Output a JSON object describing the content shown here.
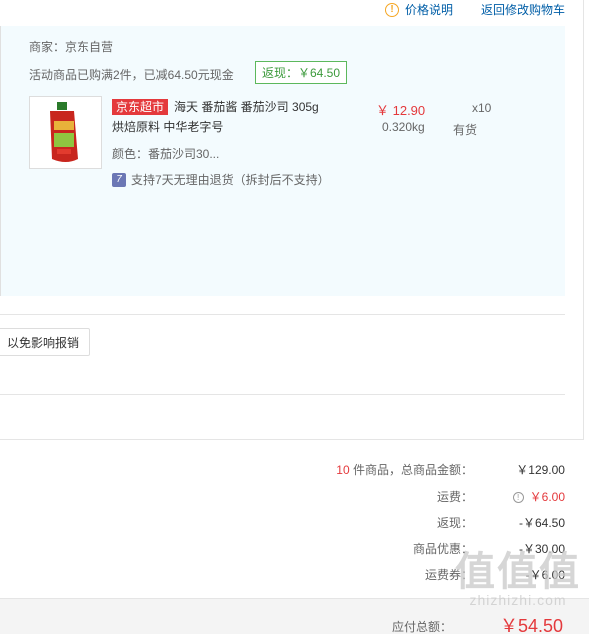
{
  "top_links": {
    "price_info": "价格说明",
    "back_to_cart": "返回修改购物车"
  },
  "shop": {
    "merchant": "商家：京东自营",
    "promo": "活动商品已购满2件，已减64.50元现金",
    "rebate_tag": "返现：￥64.50"
  },
  "product": {
    "badge": "京东超市",
    "name": "海天 番茄酱 番茄沙司 305g",
    "sub": "烘焙原料 中华老字号",
    "color": "颜色：番茄沙司30...",
    "return_policy": "支持7天无理由退货（拆封后不支持）",
    "unit_price": "￥ 12.90",
    "weight": "0.320kg",
    "qty": "x10",
    "stock": "有货"
  },
  "invoice": {
    "button_label": "以免影响报销"
  },
  "summary": {
    "count": "10",
    "total_label": "件商品，总商品金额：",
    "total_value": "￥129.00",
    "shipping_label": "运费：",
    "shipping_value": "￥6.00",
    "cashback_label": "返现：",
    "cashback_value": "-￥64.50",
    "discount_label": "商品优惠：",
    "discount_value": "-￥30.00",
    "shipping_coupon_label": "运费券：",
    "shipping_coupon_value": "-￥6.00"
  },
  "payable": {
    "label": "应付总额：",
    "value": "￥54.50"
  },
  "watermark": {
    "big": "值值值",
    "small": "zhizhizhi.com"
  },
  "colors": {
    "accent_red": "#e4393c",
    "link_blue": "#005ea7",
    "panel_bg": "#f3fbfe",
    "rebate_green": "#3c9a3c"
  }
}
